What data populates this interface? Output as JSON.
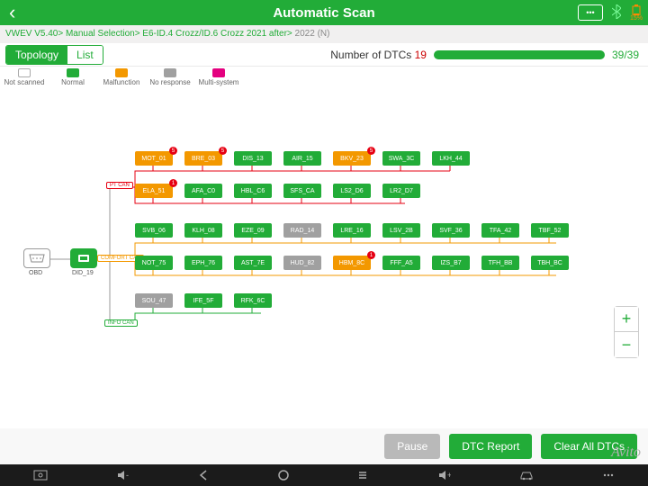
{
  "title": "Automatic Scan",
  "battery_pct": "15%",
  "breadcrumb": {
    "path": "VWEV V5.40> Manual Selection> E6-ID.4 Crozz/ID.6 Crozz 2021 after>",
    "current": " 2022 (N)"
  },
  "tabs": {
    "topology": "Topology",
    "list": "List"
  },
  "dtc": {
    "label": "Number of DTCs ",
    "count": "19",
    "progress": "39/39"
  },
  "legend": {
    "not_scanned": "Not scanned",
    "normal": "Normal",
    "malfunction": "Malfunction",
    "no_response": "No response",
    "multi": "Multi-system"
  },
  "root": {
    "obd": "OBD",
    "gateway": "DID_19"
  },
  "buses": {
    "pt": "PT CAN",
    "comfort": "COMFORT CAN",
    "info": "INFO CAN"
  },
  "nodes": {
    "row1": [
      {
        "id": "MOT_01",
        "status": "malf",
        "badge": "5"
      },
      {
        "id": "BRE_03",
        "status": "malf",
        "badge": "5"
      },
      {
        "id": "DIS_13",
        "status": "normal"
      },
      {
        "id": "AIR_15",
        "status": "normal"
      },
      {
        "id": "BKV_23",
        "status": "malf",
        "badge": "5"
      },
      {
        "id": "SWA_3C",
        "status": "normal"
      },
      {
        "id": "LKH_44",
        "status": "normal"
      }
    ],
    "row2": [
      {
        "id": "ELA_51",
        "status": "malf",
        "badge": "1"
      },
      {
        "id": "AFA_C0",
        "status": "normal"
      },
      {
        "id": "HBL_C6",
        "status": "normal"
      },
      {
        "id": "SFS_CA",
        "status": "normal"
      },
      {
        "id": "LS2_D6",
        "status": "normal"
      },
      {
        "id": "LR2_D7",
        "status": "normal"
      }
    ],
    "row3": [
      {
        "id": "SVB_06",
        "status": "normal"
      },
      {
        "id": "KLH_08",
        "status": "normal"
      },
      {
        "id": "EZE_09",
        "status": "normal"
      },
      {
        "id": "RAD_14",
        "status": "noresp"
      },
      {
        "id": "LRE_16",
        "status": "normal"
      },
      {
        "id": "LSV_2B",
        "status": "normal"
      },
      {
        "id": "SVF_36",
        "status": "normal"
      },
      {
        "id": "TFA_42",
        "status": "normal"
      },
      {
        "id": "TBF_52",
        "status": "normal"
      }
    ],
    "row4": [
      {
        "id": "NOT_75",
        "status": "normal"
      },
      {
        "id": "EPH_76",
        "status": "normal"
      },
      {
        "id": "AST_7E",
        "status": "normal"
      },
      {
        "id": "HUD_82",
        "status": "noresp"
      },
      {
        "id": "HBM_8C",
        "status": "malf",
        "badge": "1"
      },
      {
        "id": "FFF_A5",
        "status": "normal"
      },
      {
        "id": "IZS_B7",
        "status": "normal"
      },
      {
        "id": "TFH_BB",
        "status": "normal"
      },
      {
        "id": "TBH_BC",
        "status": "normal"
      }
    ],
    "row5": [
      {
        "id": "SOU_47",
        "status": "noresp"
      },
      {
        "id": "IFE_5F",
        "status": "normal"
      },
      {
        "id": "RFK_6C",
        "status": "normal"
      }
    ]
  },
  "actions": {
    "pause": "Pause",
    "report": "DTC Report",
    "clear": "Clear All DTCs"
  },
  "watermark": "Avito"
}
